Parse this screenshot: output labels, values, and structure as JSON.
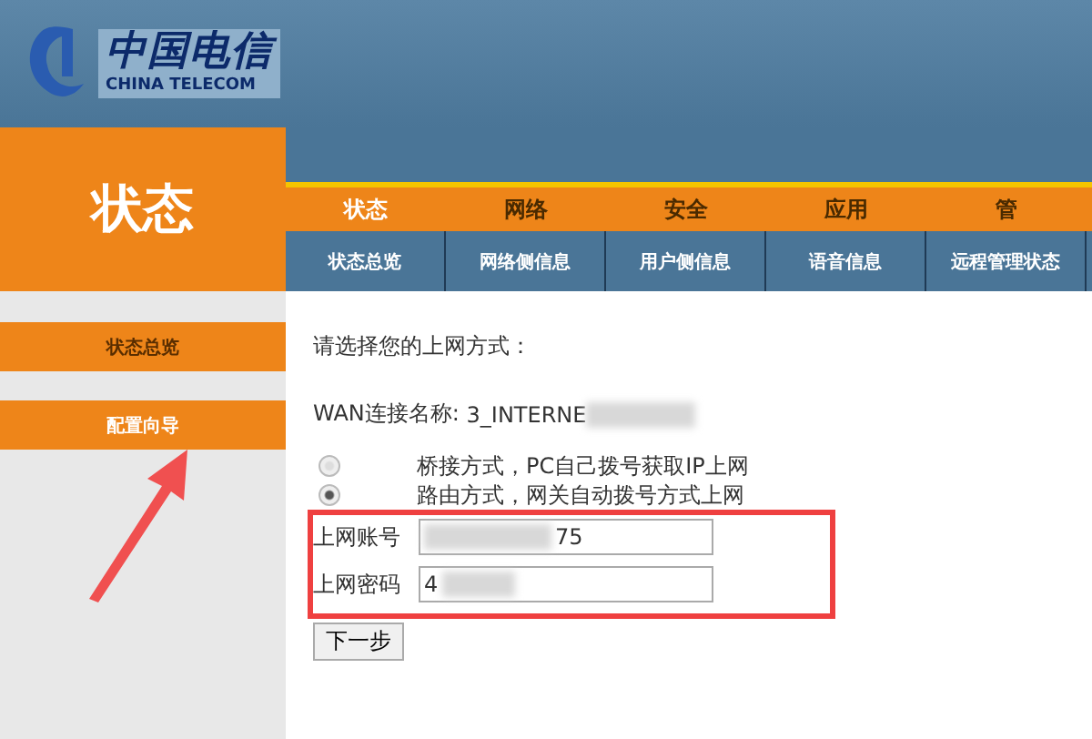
{
  "logo": {
    "name": "中国电信",
    "subtitle": "CHINA TELECOM"
  },
  "section_title": "状态",
  "main_tabs": [
    {
      "label": "状态",
      "selected": true
    },
    {
      "label": "网络",
      "selected": false
    },
    {
      "label": "安全",
      "selected": false
    },
    {
      "label": "应用",
      "selected": false
    },
    {
      "label": "管",
      "selected": false
    }
  ],
  "sub_tabs": [
    {
      "label": "状态总览",
      "selected": false
    },
    {
      "label": "网络侧信息",
      "selected": false
    },
    {
      "label": "用户侧信息",
      "selected": false
    },
    {
      "label": "语音信息",
      "selected": false
    },
    {
      "label": "远程管理状态",
      "selected": false
    }
  ],
  "sidebar": {
    "items": [
      {
        "label": "状态总览",
        "selected": false
      },
      {
        "label": "配置向导",
        "selected": true
      }
    ]
  },
  "form": {
    "prompt": "请选择您的上网方式：",
    "wan_name_label": "WAN连接名称:",
    "wan_name_value": "3_INTERNE",
    "options": [
      {
        "label": "桥接方式，PC自己拨号获取IP上网",
        "selected": false
      },
      {
        "label": "路由方式，网关自动拨号方式上网",
        "selected": true
      }
    ],
    "fields": [
      {
        "label": "上网账号",
        "value": "75"
      },
      {
        "label": "上网密码",
        "value": "4"
      }
    ],
    "next_button": "下一步"
  }
}
